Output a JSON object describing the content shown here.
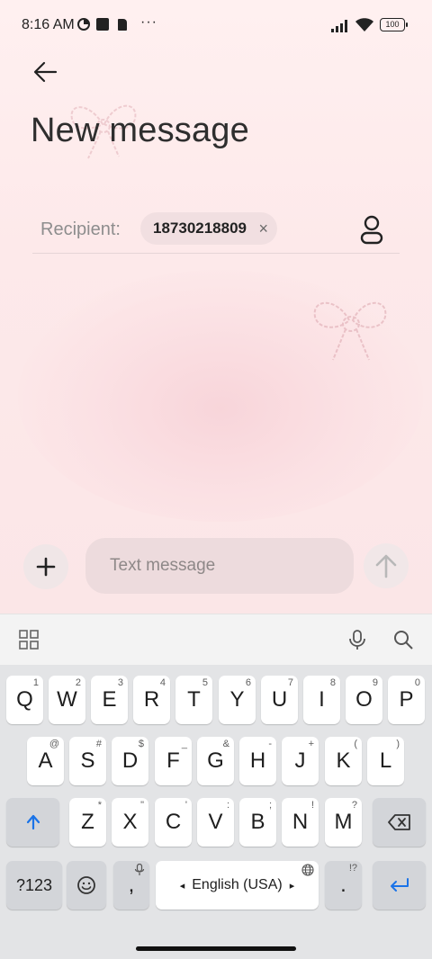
{
  "status_bar": {
    "time": "8:16 AM",
    "more": "···",
    "battery": "100"
  },
  "header": {
    "title": "New message"
  },
  "recipient": {
    "label": "Recipient:",
    "chip_number": "18730218809",
    "chip_close": "×"
  },
  "compose": {
    "placeholder": "Text message"
  },
  "keyboard": {
    "row1": [
      {
        "label": "Q",
        "hint": "1"
      },
      {
        "label": "W",
        "hint": "2"
      },
      {
        "label": "E",
        "hint": "3"
      },
      {
        "label": "R",
        "hint": "4"
      },
      {
        "label": "T",
        "hint": "5"
      },
      {
        "label": "Y",
        "hint": "6"
      },
      {
        "label": "U",
        "hint": "7"
      },
      {
        "label": "I",
        "hint": "8"
      },
      {
        "label": "O",
        "hint": "9"
      },
      {
        "label": "P",
        "hint": "0"
      }
    ],
    "row2": [
      {
        "label": "A",
        "hint": "@"
      },
      {
        "label": "S",
        "hint": "#"
      },
      {
        "label": "D",
        "hint": "$"
      },
      {
        "label": "F",
        "hint": "_"
      },
      {
        "label": "G",
        "hint": "&"
      },
      {
        "label": "H",
        "hint": "-"
      },
      {
        "label": "J",
        "hint": "+"
      },
      {
        "label": "K",
        "hint": "("
      },
      {
        "label": "L",
        "hint": ")"
      }
    ],
    "row3": [
      {
        "label": "Z",
        "hint": "*"
      },
      {
        "label": "X",
        "hint": "\""
      },
      {
        "label": "C",
        "hint": "'"
      },
      {
        "label": "V",
        "hint": ":"
      },
      {
        "label": "B",
        "hint": ";"
      },
      {
        "label": "N",
        "hint": "!"
      },
      {
        "label": "M",
        "hint": "?"
      }
    ],
    "symbols_key": "?123",
    "comma_key": ",",
    "period_key": ".",
    "period_hint": "!?",
    "space_label": "English (USA)",
    "space_left": "◂",
    "space_right": "▸",
    "emoji_icon": "emoji-icon",
    "shift_icon": "shift-arrow-icon",
    "backspace_icon": "backspace-icon",
    "enter_icon": "enter-icon"
  },
  "colors": {
    "app_bg": "#fdeeee",
    "accent_blue": "#1a73e8",
    "chip_bg": "#f1dfe1",
    "input_bg": "#eddbdd"
  }
}
